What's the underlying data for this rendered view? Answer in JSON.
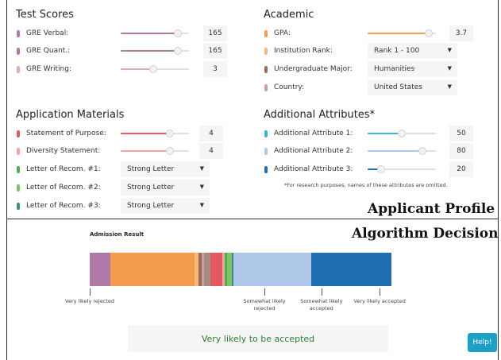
{
  "test_scores": {
    "title": "Test Scores",
    "items": [
      {
        "label": "GRE Verbal:",
        "value": "165",
        "color": "#b07aa8",
        "level": 0.84
      },
      {
        "label": "GRE Quant.:",
        "value": "165",
        "color": "#b07aa8",
        "level": 0.84
      },
      {
        "label": "GRE Writing:",
        "value": "3",
        "color": "#e0a6c5",
        "level": 0.48
      }
    ]
  },
  "academic": {
    "title": "Academic",
    "gpa": {
      "label": "GPA:",
      "value": "3.7",
      "color": "#f39c4e",
      "level": 0.9
    },
    "selects": [
      {
        "label": "Institution Rank:",
        "value": "Rank 1 - 100",
        "color": "#f5b97d"
      },
      {
        "label": "Undergraduate Major:",
        "value": "Humanities",
        "color": "#9e6a5a"
      },
      {
        "label": "Country:",
        "value": "United States",
        "color": "#c9a39a"
      }
    ]
  },
  "application_materials": {
    "title": "Application Materials",
    "sliders": [
      {
        "label": "Statement of Purpose:",
        "value": "4",
        "color": "#e05a60",
        "level": 0.72
      },
      {
        "label": "Diversity Statement:",
        "value": "4",
        "color": "#f4a3a3",
        "level": 0.72
      }
    ],
    "selects": [
      {
        "label": "Letter of Recom. #1:",
        "value": "Strong Letter",
        "color": "#4caf50"
      },
      {
        "label": "Letter of Recom. #2:",
        "value": "Strong Letter",
        "color": "#7cc36a"
      },
      {
        "label": "Letter of Recom. #3:",
        "value": "Strong Letter",
        "color": "#3d8b84"
      }
    ]
  },
  "additional_attributes": {
    "title": "Additional Attributes*",
    "items": [
      {
        "label": "Additional Attribute 1:",
        "value": "50",
        "color": "#3fb6d1",
        "level": 0.5
      },
      {
        "label": "Additional Attribute 2:",
        "value": "80",
        "color": "#aec7e8",
        "level": 0.8
      },
      {
        "label": "Additional Attribute 3:",
        "value": "20",
        "color": "#1f6fb2",
        "level": 0.2
      }
    ],
    "footnote": "*For research purposes, names of these attributes are omitted."
  },
  "overlay": {
    "profile": "Applicant Profile",
    "decision": "Algorithm Decision"
  },
  "admission_result": {
    "title": "Admission Result",
    "segments": [
      {
        "name": "gre",
        "color": "#b07aa8",
        "share": 0.069
      },
      {
        "name": "gpa",
        "color": "#f39c4e",
        "share": 0.276
      },
      {
        "name": "institution-rank",
        "color": "#f5b97d",
        "share": 0.013
      },
      {
        "name": "major",
        "color": "#9e6a5a",
        "share": 0.008
      },
      {
        "name": "country",
        "color": "#c9a39a",
        "share": 0.008
      },
      {
        "name": "gre-quant",
        "color": "#a58b83",
        "share": 0.021
      },
      {
        "name": "statement-of-purpose",
        "color": "#e05a60",
        "share": 0.039
      },
      {
        "name": "diversity-statement",
        "color": "#f4a3a3",
        "share": 0.008
      },
      {
        "name": "letter-1",
        "color": "#4caf50",
        "share": 0.008
      },
      {
        "name": "letter-2",
        "color": "#7cc36a",
        "share": 0.016
      },
      {
        "name": "letter-3",
        "color": "#3d8b84",
        "share": 0.005
      },
      {
        "name": "attribute-2",
        "color": "#aec7e8",
        "share": 0.255
      },
      {
        "name": "attribute-3",
        "color": "#1f6fb2",
        "share": 0.263
      }
    ],
    "ticks": [
      {
        "label": "Very likely rejected",
        "pos": 0.0
      },
      {
        "label": "Somewhat likely rejected",
        "pos": 0.573
      },
      {
        "label": "Somewhat likely accepted",
        "pos": 0.76
      },
      {
        "label": "Very likely accepted",
        "pos": 0.951
      }
    ],
    "result_text": "Very likely to be accepted",
    "result_color": "#2e7d32"
  },
  "help_label": "Help!"
}
